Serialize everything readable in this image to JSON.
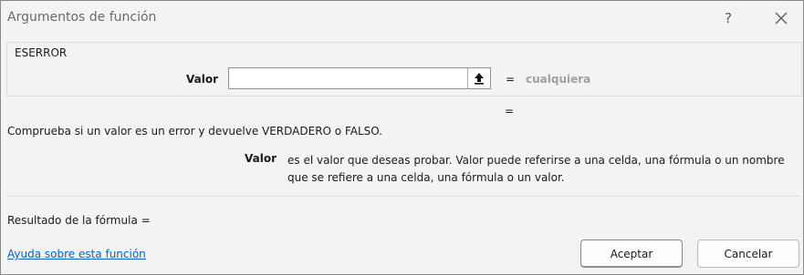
{
  "dialog": {
    "title": "Argumentos de función",
    "help_glyph": "?",
    "close_icon": "close-icon"
  },
  "function_group": {
    "name": "ESERROR",
    "arguments": [
      {
        "label": "Valor",
        "input_value": "",
        "equals": "=",
        "evaluated_value": "cualquiera"
      }
    ]
  },
  "result_equals": "=",
  "description": "Comprueba si un valor es un error y devuelve VERDADERO o FALSO.",
  "argument_help": {
    "name": "Valor",
    "text": "es el valor que deseas probar. Valor puede referirse a una celda, una fórmula o un nombre que se refiere a una celda, una fórmula o un valor."
  },
  "formula_result": "Resultado de la fórmula =",
  "help_link": "Ayuda sobre esta función",
  "buttons": {
    "ok": "Aceptar",
    "cancel": "Cancelar"
  },
  "colors": {
    "background": "#f3f3f3",
    "link": "#0b63b8",
    "muted_value": "#a0a0a0"
  }
}
